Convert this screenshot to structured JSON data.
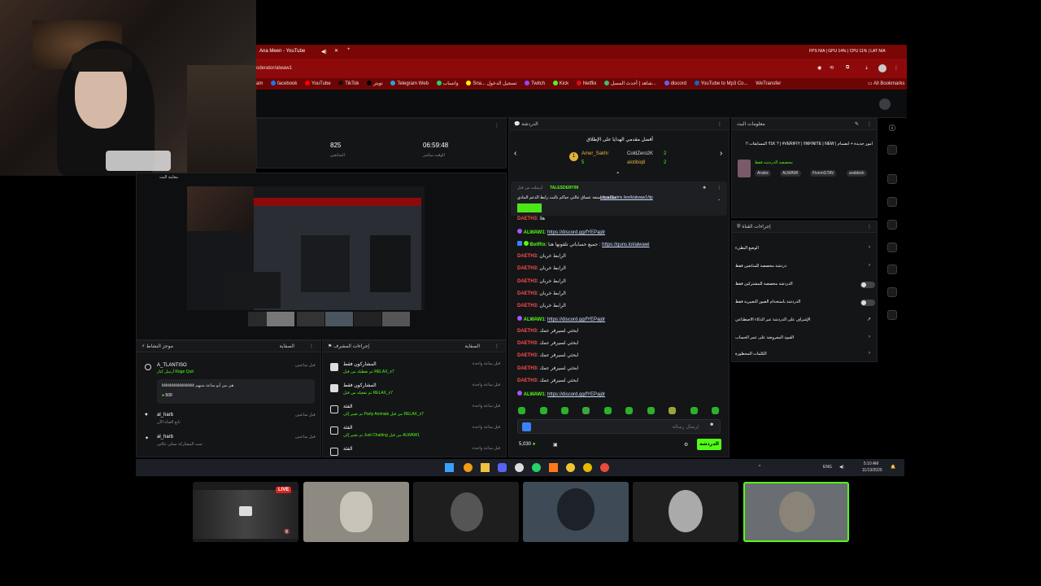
{
  "browser": {
    "tab_title": "Ana Meen - YouTube",
    "address": "oderator/alwaw1",
    "address_prefix": "am",
    "stats": [
      {
        "label": "FPS",
        "value": "N/A"
      },
      {
        "label": "GPU",
        "value": "14%"
      },
      {
        "label": "CPU",
        "value": "11%"
      },
      {
        "label": "LAT",
        "value": "N/A"
      }
    ],
    "bookmarks": [
      "facebook",
      "YouTube",
      "TikTok",
      "تويتر",
      "Telegram Web",
      "واتساب",
      "Sna... تسجيل الدخول",
      "Twitch",
      "Kick",
      "Netflix",
      "شاهد | أحدث المسل...",
      "discord",
      "YouTube to Mp3 Co...",
      "WeTransfer"
    ],
    "all_bookmarks": "All Bookmarks",
    "accent": "#8e0a0a"
  },
  "dashboard": {
    "followers_value": "825",
    "followers_label": "المتابعين",
    "time_value": "06:59:48",
    "time_label": "الوقت مباشر",
    "preview_label": "معاينة البث"
  },
  "activity": {
    "title": "موجز النشاط",
    "header_right": "الصفاية",
    "items": [
      {
        "user": "A_TLANTISO",
        "action": "أرسل كتاز Rage Quit",
        "time": "قبل ساعتين"
      },
      {
        "user": "al_harb",
        "action": "تابع القناة الآن",
        "time": "قبل ساعتين"
      },
      {
        "user": "al_harb",
        "action": "تمت المشاركة سنلي عالتي",
        "time": "قبل ساعتين"
      }
    ],
    "message": "kkkkkkkkkkkkkkkk هي من أبو ساعة متبهم",
    "kicks_amount": "500"
  },
  "mod_actions": {
    "title": "إجراءات المشرف",
    "header_right": "الصفاية",
    "items": [
      {
        "title": "المشاركون فقط",
        "detail": "تم تعطيله من قبل RELAX_x7",
        "time": "قبل ساعة واحدة"
      },
      {
        "title": "المشاركون فقط",
        "detail": "تم تفعيله من قبل RELAX_x7",
        "time": "قبل ساعة واحدة"
      },
      {
        "title": "الفئة",
        "detail": "تم تغيير إلى Party Animals من قبل RELAX_x7",
        "time": "قبل ساعة واحدة"
      },
      {
        "title": "الفئة",
        "detail": "تم تغيير إلى Just Chatting من قبل ALWAW1",
        "time": "قبل ساعة واحدة"
      },
      {
        "title": "الفئة",
        "detail": "",
        "time": "قبل ساعة واحدة"
      }
    ]
  },
  "chat": {
    "title": "الدردشة",
    "leaderboard_title": "أفضل مقدمي الهدايا على الإطلاق",
    "leaders": [
      {
        "rank": "1",
        "name": "Amer_Sakhr",
        "count": "5"
      },
      {
        "name": "ColdZero2K",
        "count": "2"
      },
      {
        "name": "alotibiq8",
        "count": "2"
      }
    ],
    "pinned_user": "TALESDERY99",
    "pinned_by": "أرسلت من قبل",
    "pinned_text": "مشاهدة ممتعة عساق عالتي حياكم بالبث رابط الدعم المادي",
    "pinned_link": "https://botrix.live/k/alwaw1/tip",
    "lines": [
      {
        "user": "DAETH3",
        "text": "هلا",
        "kind": "red"
      },
      {
        "user": "ALWAW1",
        "text": "https://discord.gg/fYEPajdr",
        "kind": "link"
      },
      {
        "user": "BotRix",
        "text": "جميع حساباتي تلقونها هنا",
        "link": "https://guns.lol/alwawi",
        "kind": "bot"
      },
      {
        "user": "DAETH3",
        "text": "الرابط خربان",
        "kind": "red"
      },
      {
        "user": "DAETH3",
        "text": "الرابط خربان",
        "kind": "red"
      },
      {
        "user": "DAETH3",
        "text": "الرابط خربان",
        "kind": "red"
      },
      {
        "user": "DAETH3",
        "text": "الرابط خربان",
        "kind": "red"
      },
      {
        "user": "DAETH3",
        "text": "الرابط خربان",
        "kind": "red"
      },
      {
        "user": "ALWAW1",
        "text": "https://discord.gg/fYEPajdr",
        "kind": "link"
      },
      {
        "user": "DAETH3",
        "text": "ابحثي لسيرفر عمك",
        "kind": "red"
      },
      {
        "user": "DAETH3",
        "text": "ابحثي لسيرفر عمك",
        "kind": "red"
      },
      {
        "user": "DAETH3",
        "text": "ابحثي لسيرفر عمك",
        "kind": "red"
      },
      {
        "user": "DAETH3",
        "text": "ابحثي لسيرفر عمك",
        "kind": "red"
      },
      {
        "user": "DAETH3",
        "text": "ابحثي لسيرفر عمك",
        "kind": "red"
      },
      {
        "user": "ALWAW1",
        "text": "https://discord.gg/fYEPajdr",
        "kind": "link"
      }
    ],
    "input_placeholder": "إرسال رسالة",
    "points": "5,030",
    "send_label": "الدردشة"
  },
  "stream_info": {
    "title": "معلومات البث",
    "stream_title": "امور جديدة + انضمام | 1K ? | #VERIFIY | !INFINITE | NEW!! المسابقات !!",
    "category": "مخصصة الدردشة فقط",
    "tags": [
      "Arabic",
      "ALWAWI",
      "FivemGTAV",
      "arabkick"
    ]
  },
  "channel_actions": {
    "title": "إجراءات القناة",
    "items": [
      {
        "label": "الوضع البطيء",
        "control": "chevron"
      },
      {
        "label": "دردشة مخصصة للمتابعين فقط",
        "control": "chevron"
      },
      {
        "label": "الدردشة مخصصة للمشتركين فقط",
        "control": "toggle"
      },
      {
        "label": "الدردشة باستخدام الصور التعبيرية فقط",
        "control": "toggle"
      },
      {
        "label": "الإشراف على الدردشة عبر الذكاء الاصطناعي",
        "control": "external"
      },
      {
        "label": "القيود المفروضة على عمر الحساب",
        "control": "chevron"
      },
      {
        "label": "الكلمات المحظورة",
        "control": "chevron"
      }
    ]
  },
  "taskbar": {
    "lang": "ENG",
    "time": "5:10 AM",
    "date": "11/13/2025"
  },
  "participants": {
    "live_label": "LIVE"
  },
  "colors": {
    "kick_green": "#53fc18",
    "chat_red": "#ff4d4d"
  }
}
